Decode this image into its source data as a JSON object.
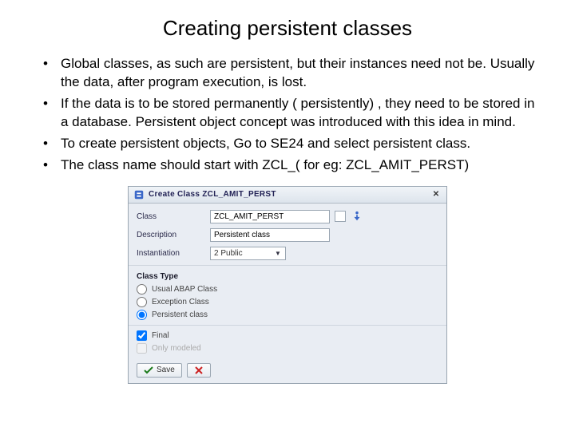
{
  "title": "Creating persistent classes",
  "bullets": [
    "Global classes, as such are persistent, but their instances need not be. Usually the data, after program execution, is lost.",
    "If the data is to be stored permanently ( persistently) , they need to be stored in a database. Persistent object concept was introduced with this idea in mind.",
    "To create persistent objects, Go to SE24 and select persistent class.",
    "The class name should start with ZCL_( for eg: ZCL_AMIT_PERST)"
  ],
  "dialog": {
    "title": "Create Class ZCL_AMIT_PERST",
    "class_label": "Class",
    "class_value": "ZCL_AMIT_PERST",
    "desc_label": "Description",
    "desc_value": "Persistent class",
    "inst_label": "Instantiation",
    "inst_value": "2 Public",
    "section": "Class Type",
    "radios": [
      {
        "label": "Usual ABAP Class",
        "checked": false
      },
      {
        "label": "Exception Class",
        "checked": false
      },
      {
        "label": "Persistent class",
        "checked": true
      }
    ],
    "checks": [
      {
        "label": "Final",
        "checked": true,
        "disabled": false
      },
      {
        "label": "Only modeled",
        "checked": false,
        "disabled": true
      }
    ],
    "save": "Save"
  }
}
